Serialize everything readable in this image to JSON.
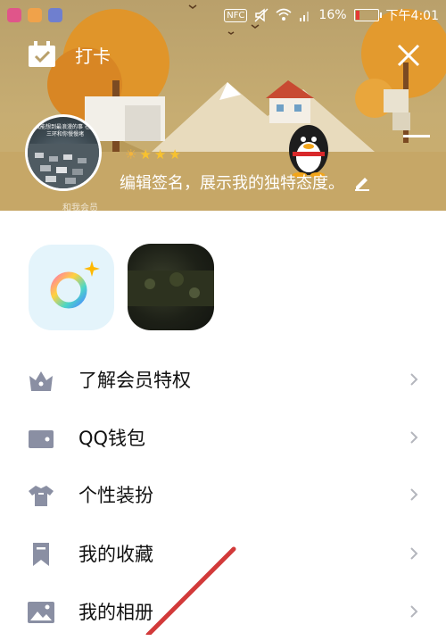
{
  "status_bar": {
    "nfc": "NFC",
    "battery": "16%",
    "time": "下午4:01",
    "battery_level": 0.16
  },
  "header": {
    "checkin_label": "打卡",
    "avatar_caption": "我能想到最浪漫的事 在南三环和你慢慢堵",
    "level_icons": [
      "sun-icon",
      "star-icon",
      "star-icon",
      "star-icon"
    ],
    "signature": "编辑签名，展示我的独特态度。",
    "flag_text": "和我会员"
  },
  "shortcuts": [
    {
      "name": "color-ring-app"
    },
    {
      "name": "dark-scene-app"
    }
  ],
  "menu": [
    {
      "label": "了解会员特权",
      "icon": "crown-icon"
    },
    {
      "label": "QQ钱包",
      "icon": "wallet-icon"
    },
    {
      "label": "个性装扮",
      "icon": "shirt-icon"
    },
    {
      "label": "我的收藏",
      "icon": "bookmark-icon"
    },
    {
      "label": "我的相册",
      "icon": "photo-icon"
    }
  ],
  "colors": {
    "banner": "#c7ad72",
    "icon_gray": "#8a8fa3",
    "annotation": "#d23a3a"
  }
}
